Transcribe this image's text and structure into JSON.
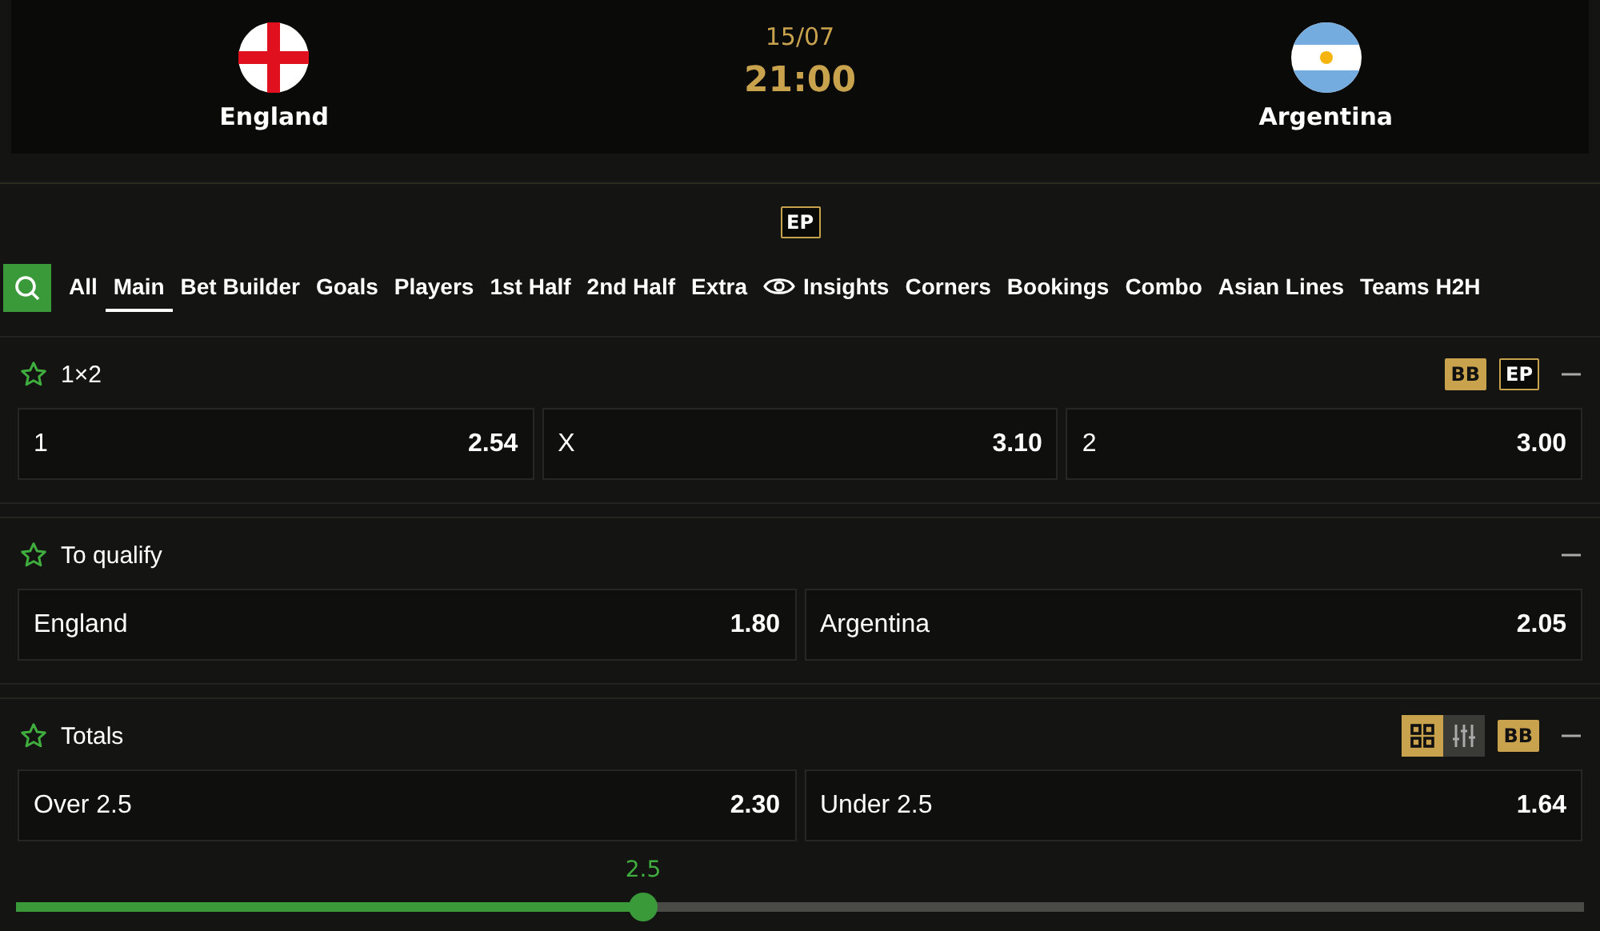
{
  "match": {
    "home": {
      "name": "England",
      "kind": "england"
    },
    "away": {
      "name": "Argentina",
      "kind": "argentina"
    },
    "date": "15/07",
    "time": "21:00",
    "badge": "EP"
  },
  "tabs": [
    {
      "label": "All",
      "selected": false
    },
    {
      "label": "Main",
      "selected": true
    },
    {
      "label": "Bet Builder",
      "selected": false
    },
    {
      "label": "Goals",
      "selected": false
    },
    {
      "label": "Players",
      "selected": false
    },
    {
      "label": "1st Half",
      "selected": false
    },
    {
      "label": "2nd Half",
      "selected": false
    },
    {
      "label": "Extra",
      "selected": false
    },
    {
      "label": "Insights",
      "selected": false,
      "kind": "eye"
    },
    {
      "label": "Corners",
      "selected": false
    },
    {
      "label": "Bookings",
      "selected": false
    },
    {
      "label": "Combo",
      "selected": false
    },
    {
      "label": "Asian Lines",
      "selected": false
    },
    {
      "label": "Teams H2H",
      "selected": false
    }
  ],
  "markets": [
    {
      "title": "1×2",
      "badges": [
        {
          "label": "BB",
          "kind": "filled"
        },
        {
          "label": "EP",
          "kind": "outline"
        }
      ],
      "outcomes": [
        {
          "label": "1",
          "odds": "2.54"
        },
        {
          "label": "X",
          "odds": "3.10"
        },
        {
          "label": "2",
          "odds": "3.00"
        }
      ]
    },
    {
      "title": "To qualify",
      "outcomes": [
        {
          "label": "England",
          "odds": "1.80"
        },
        {
          "label": "Argentina",
          "odds": "2.05"
        }
      ]
    },
    {
      "title": "Totals",
      "view_toggle": [
        {
          "kind": "grid",
          "selected": true
        },
        {
          "kind": "sliders",
          "selected": false
        }
      ],
      "badges": [
        {
          "label": "BB",
          "kind": "filled"
        }
      ],
      "outcomes": [
        {
          "label": "Over 2.5",
          "odds": "2.30"
        },
        {
          "label": "Under 2.5",
          "odds": "1.64"
        }
      ],
      "slider": {
        "reading": "2.5",
        "level": 0.4
      }
    }
  ]
}
